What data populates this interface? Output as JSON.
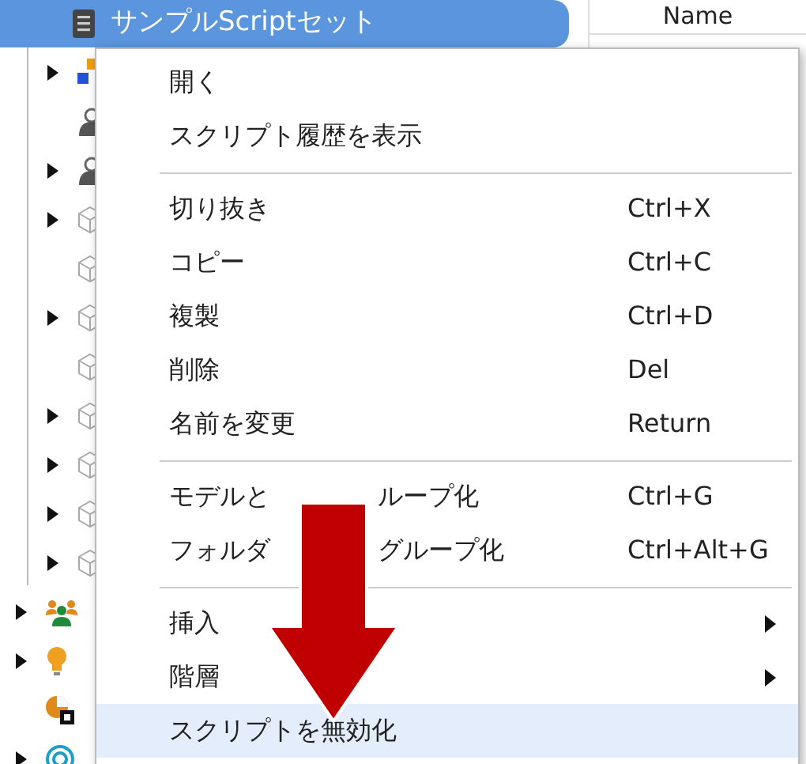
{
  "tree": {
    "label": "サンプルScriptセット",
    "selected": true,
    "children": [
      {
        "kind": "model",
        "has_children": true
      },
      {
        "kind": "user",
        "has_children": false
      },
      {
        "kind": "user",
        "has_children": true
      },
      {
        "kind": "cube",
        "has_children": true
      },
      {
        "kind": "cube",
        "has_children": false
      },
      {
        "kind": "cube",
        "has_children": true
      },
      {
        "kind": "cube",
        "has_children": false
      },
      {
        "kind": "cube",
        "has_children": true
      },
      {
        "kind": "cube",
        "has_children": true
      },
      {
        "kind": "cube",
        "has_children": true
      },
      {
        "kind": "cube",
        "has_children": true
      }
    ],
    "siblings": [
      {
        "kind": "people",
        "has_children": true
      },
      {
        "kind": "bulb",
        "has_children": true
      },
      {
        "kind": "pie",
        "has_children": false
      },
      {
        "kind": "target",
        "has_children": true
      }
    ]
  },
  "panel": {
    "column": "Name"
  },
  "menu": {
    "items": [
      {
        "kind": "item",
        "label": "開く",
        "highlighted": false
      },
      {
        "kind": "item",
        "label": "スクリプト履歴を表示",
        "highlighted": false
      },
      {
        "kind": "separator"
      },
      {
        "kind": "item",
        "label": "切り抜き",
        "shortcut": "Ctrl+X",
        "highlighted": false
      },
      {
        "kind": "item",
        "label": "コピー",
        "shortcut": "Ctrl+C",
        "highlighted": false
      },
      {
        "kind": "item",
        "label": "複製",
        "shortcut": "Ctrl+D",
        "highlighted": false
      },
      {
        "kind": "item",
        "label": "削除",
        "shortcut": "Del",
        "highlighted": false
      },
      {
        "kind": "item",
        "label": "名前を変更",
        "shortcut": "Return",
        "highlighted": false
      },
      {
        "kind": "separator"
      },
      {
        "kind": "covered",
        "label_parts": [
          "モデルと",
          "ループ化"
        ],
        "shortcut": "Ctrl+G",
        "highlighted": false
      },
      {
        "kind": "covered",
        "label_parts": [
          "フォルダ",
          "グループ化"
        ],
        "shortcut": "Ctrl+Alt+G",
        "highlighted": false
      },
      {
        "kind": "separator"
      },
      {
        "kind": "submenu",
        "label": "挿入",
        "highlighted": false
      },
      {
        "kind": "submenu",
        "label": "階層",
        "highlighted": false
      },
      {
        "kind": "item",
        "label": "スクリプトを無効化",
        "highlighted": true
      }
    ]
  }
}
